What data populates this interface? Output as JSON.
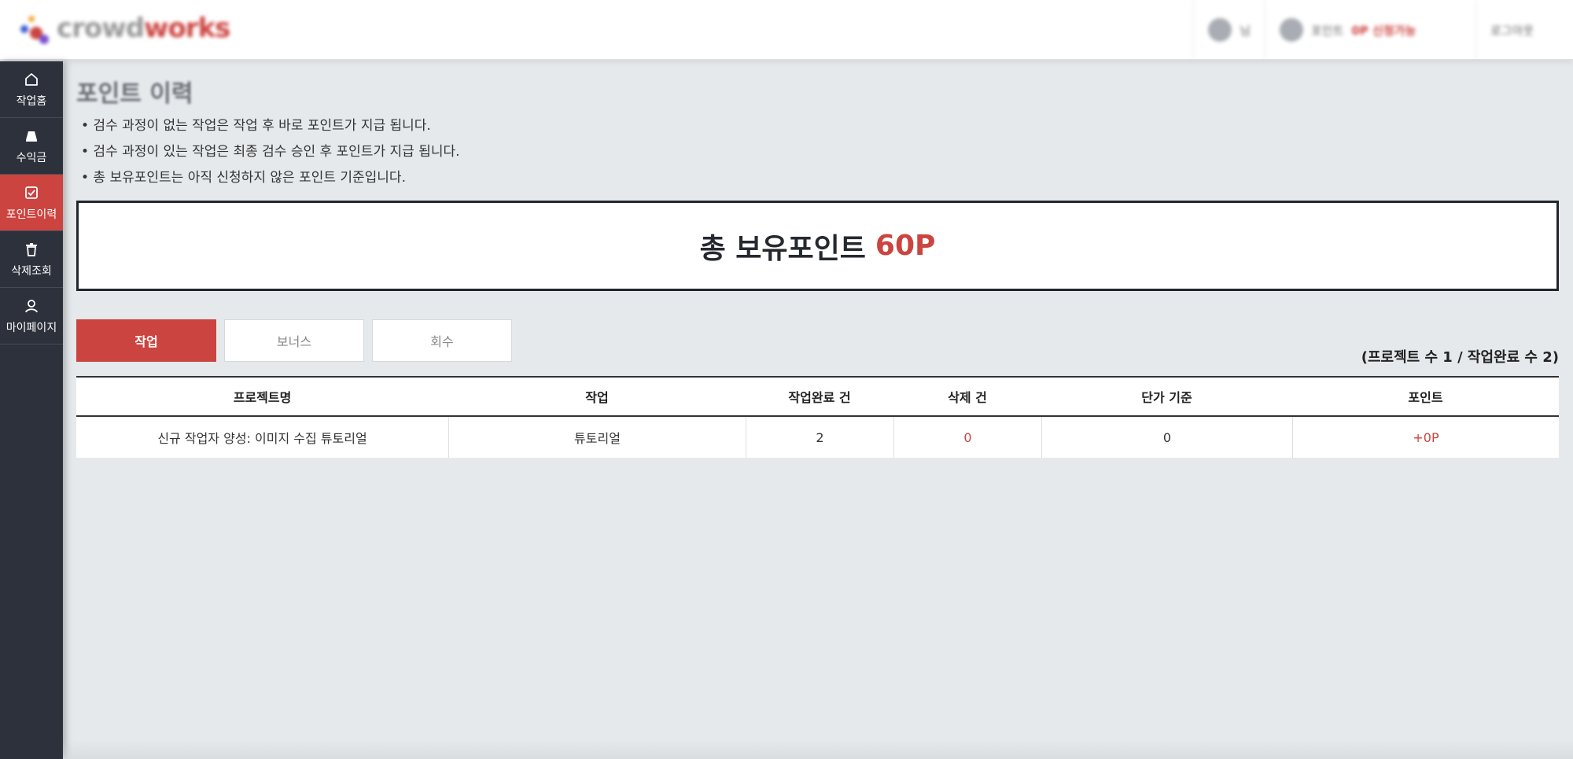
{
  "header": {
    "logo": {
      "text_a": "crowd",
      "text_b": "works",
      "dot_colors": [
        "#cc4440",
        "#3b5bd6",
        "#f2a93b",
        "#7a4fd1"
      ]
    },
    "user_label": "님",
    "points_label": "포인트",
    "points_badge": "0P 신청가능",
    "logout_label": "로그아웃"
  },
  "sidebar": {
    "items": [
      {
        "label": "작업홈",
        "icon": "home-icon",
        "active": false
      },
      {
        "label": "수익금",
        "icon": "coin-stack-icon",
        "active": false
      },
      {
        "label": "포인트이력",
        "icon": "history-check-icon",
        "active": true
      },
      {
        "label": "삭제조회",
        "icon": "trash-icon",
        "active": false
      },
      {
        "label": "마이페이지",
        "icon": "user-icon",
        "active": false
      }
    ]
  },
  "main": {
    "title": "포인트 이력",
    "notices": [
      "• 검수 과정이 없는 작업은 작업 후 바로 포인트가 지급 됩니다.",
      "• 검수 과정이 있는 작업은 최종 검수 승인 후 포인트가 지급 됩니다.",
      "• 총 보유포인트는 아직 신청하지 않은 포인트 기준입니다."
    ],
    "total": {
      "label": "총 보유포인트",
      "value": "60P"
    },
    "tabs": [
      {
        "label": "작업",
        "active": true
      },
      {
        "label": "보너스",
        "active": false
      },
      {
        "label": "회수",
        "active": false
      }
    ],
    "summary": "(프로젝트 수 1 / 작업완료 수 2)",
    "table": {
      "headers": [
        "프로젝트명",
        "작업",
        "작업완료 건",
        "삭제 건",
        "단가 기준",
        "포인트"
      ],
      "rows": [
        [
          "신규 작업자 양성: 이미지 수집 튜토리얼",
          "튜토리얼",
          "2",
          "0",
          "0",
          "+0P"
        ]
      ]
    }
  },
  "colors": {
    "accent": "#cc4440",
    "sidebar": "#2d313c",
    "background": "#e6e9ec"
  }
}
